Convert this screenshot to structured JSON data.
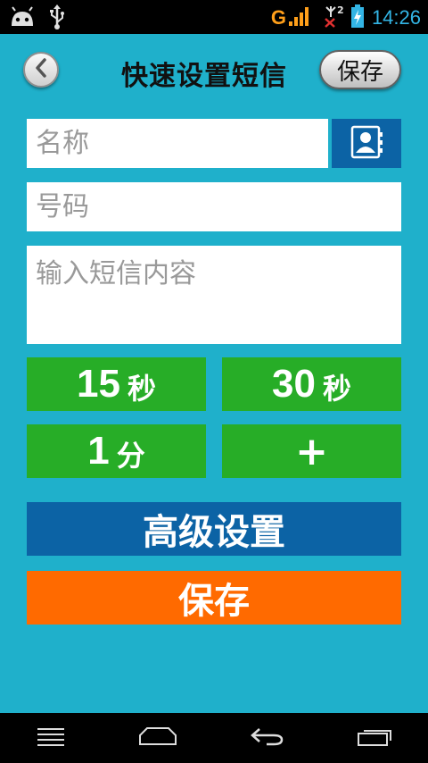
{
  "status_bar": {
    "time": "14:26",
    "network_label": "G",
    "sim_badge": "2",
    "icons": [
      "android-icon",
      "usb-icon",
      "signal-icon",
      "no-sim-icon",
      "battery-icon"
    ]
  },
  "header": {
    "title": "快速设置短信",
    "save_label": "保存"
  },
  "form": {
    "name_placeholder": "名称",
    "phone_placeholder": "号码",
    "message_placeholder": "输入短信内容"
  },
  "presets": [
    {
      "value": "15",
      "unit": "秒"
    },
    {
      "value": "30",
      "unit": "秒"
    },
    {
      "value": "1",
      "unit": "分"
    },
    {
      "value": "+"
    }
  ],
  "buttons": {
    "advanced_label": "高级设置",
    "save_label": "保存"
  },
  "colors": {
    "background": "#1fb0cb",
    "preset_green": "#27ad27",
    "advanced_blue": "#0c63a5",
    "save_orange": "#ff6a00",
    "status_blue": "#33b5e5"
  },
  "nav_icons": [
    "menu-icon",
    "home-icon",
    "back-icon",
    "recent-apps-icon"
  ]
}
